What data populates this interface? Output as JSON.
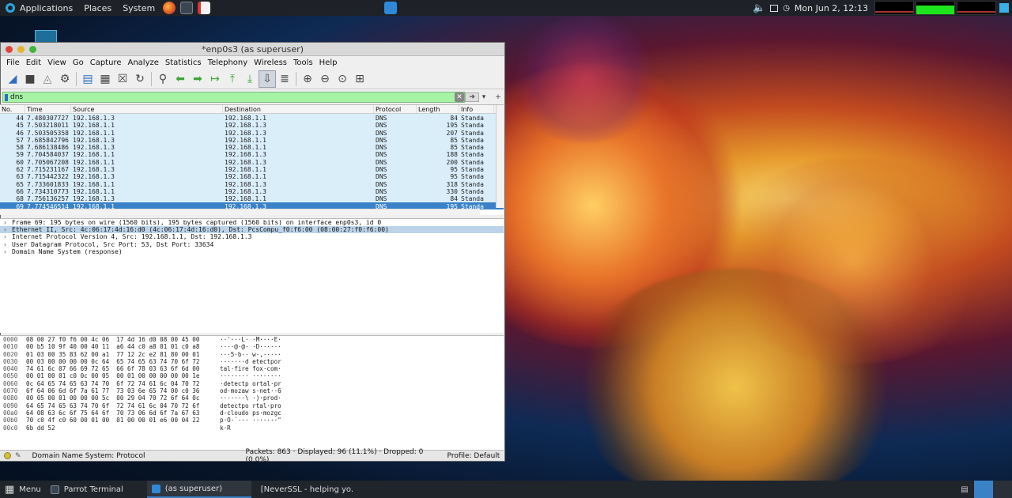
{
  "top_panel": {
    "menus": [
      "Applications",
      "Places",
      "System"
    ],
    "datetime": "Mon Jun 2, 12:13"
  },
  "window": {
    "title": "*enp0s3 (as superuser)",
    "menus": [
      "File",
      "Edit",
      "View",
      "Go",
      "Capture",
      "Analyze",
      "Statistics",
      "Telephony",
      "Wireless",
      "Tools",
      "Help"
    ],
    "filter": "dns"
  },
  "packet_list": {
    "columns": [
      "No.",
      "Time",
      "Source",
      "Destination",
      "Protocol",
      "Length",
      "Info"
    ],
    "rows": [
      [
        "44",
        "7.480307727",
        "192.168.1.3",
        "192.168.1.1",
        "DNS",
        "84",
        "Standa"
      ],
      [
        "45",
        "7.503218011",
        "192.168.1.1",
        "192.168.1.3",
        "DNS",
        "195",
        "Standa"
      ],
      [
        "46",
        "7.503505358",
        "192.168.1.1",
        "192.168.1.3",
        "DNS",
        "207",
        "Standa"
      ],
      [
        "57",
        "7.685842796",
        "192.168.1.3",
        "192.168.1.1",
        "DNS",
        "85",
        "Standa"
      ],
      [
        "58",
        "7.686138486",
        "192.168.1.3",
        "192.168.1.1",
        "DNS",
        "85",
        "Standa"
      ],
      [
        "59",
        "7.704584037",
        "192.168.1.1",
        "192.168.1.3",
        "DNS",
        "188",
        "Standa"
      ],
      [
        "60",
        "7.705067208",
        "192.168.1.1",
        "192.168.1.3",
        "DNS",
        "200",
        "Standa"
      ],
      [
        "62",
        "7.715231167",
        "192.168.1.3",
        "192.168.1.1",
        "DNS",
        "95",
        "Standa"
      ],
      [
        "63",
        "7.715442322",
        "192.168.1.3",
        "192.168.1.1",
        "DNS",
        "95",
        "Standa"
      ],
      [
        "65",
        "7.733601833",
        "192.168.1.1",
        "192.168.1.3",
        "DNS",
        "318",
        "Standa"
      ],
      [
        "66",
        "7.734310773",
        "192.168.1.1",
        "192.168.1.3",
        "DNS",
        "330",
        "Standa"
      ],
      [
        "68",
        "7.756136257",
        "192.168.1.3",
        "192.168.1.1",
        "DNS",
        "84",
        "Standa"
      ],
      [
        "69",
        "7.774546514",
        "192.168.1.1",
        "192.168.1.3",
        "DNS",
        "195",
        "Standa"
      ]
    ]
  },
  "details": [
    "Frame 69: 195 bytes on wire (1560 bits), 195 bytes captured (1560 bits) on interface enp0s3, id 0",
    "Ethernet II, Src: 4c:06:17:4d:16:d0 (4c:06:17:4d:16:d0), Dst: PcsCompu_f0:f6:00 (08:00:27:f0:f6:00)",
    "Internet Protocol Version 4, Src: 192.168.1.1, Dst: 192.168.1.3",
    "User Datagram Protocol, Src Port: 53, Dst Port: 33634",
    "Domain Name System (response)"
  ],
  "hex": [
    [
      "0000",
      "08 00 27 f0 f6 00 4c 06  17 4d 16 d0 08 00 45 00",
      "··'···L· ·M····E·"
    ],
    [
      "0010",
      "00 b5 10 9f 40 00 40 11  a6 44 c0 a8 01 01 c0 a8",
      "····@·@· ·D······"
    ],
    [
      "0020",
      "01 03 00 35 83 62 00 a1  77 12 2c e2 81 80 00 01",
      "···5·b·· w·,·····"
    ],
    [
      "0030",
      "00 03 00 00 00 00 0c 64  65 74 65 63 74 70 6f 72",
      "·······d etectpor"
    ],
    [
      "0040",
      "74 61 6c 07 66 69 72 65  66 6f 78 03 63 6f 6d 00",
      "tal·fire fox·com·"
    ],
    [
      "0050",
      "00 01 00 01 c0 0c 00 05  00 01 00 00 00 00 00 1e",
      "········ ········"
    ],
    [
      "0060",
      "0c 64 65 74 65 63 74 70  6f 72 74 61 6c 04 70 72",
      "·detectp ortal·pr"
    ],
    [
      "0070",
      "6f 64 06 6d 6f 7a 61 77  73 03 6e 65 74 00 c0 36",
      "od·mozaw s·net··6"
    ],
    [
      "0080",
      "00 05 00 01 00 00 00 5c  00 29 04 70 72 6f 64 0c",
      "·······\\ ·)·prod·"
    ],
    [
      "0090",
      "64 65 74 65 63 74 70 6f  72 74 61 6c 04 70 72 6f",
      "detectpo rtal·pro"
    ],
    [
      "00a0",
      "64 08 63 6c 6f 75 64 6f  70 73 06 6d 6f 7a 67 63",
      "d·cloudo ps·mozgc"
    ],
    [
      "00b0",
      "70 c0 4f c0 60 00 01 00  01 00 00 01 e6 00 04 22",
      "p·O·`··· ·······\""
    ],
    [
      "00c0",
      "6b dd 52",
      "k·R"
    ]
  ],
  "status": {
    "protocol_info": "Domain Name System: Protocol",
    "packets": "Packets: 863 · Displayed: 96 (11.1%) · Dropped: 0 (0.0%)",
    "profile": "Profile: Default"
  },
  "taskbar": {
    "menu": "Menu",
    "tasks": [
      "Parrot Terminal",
      "(as superuser)",
      "[NeverSSL - helping yo..."
    ]
  }
}
